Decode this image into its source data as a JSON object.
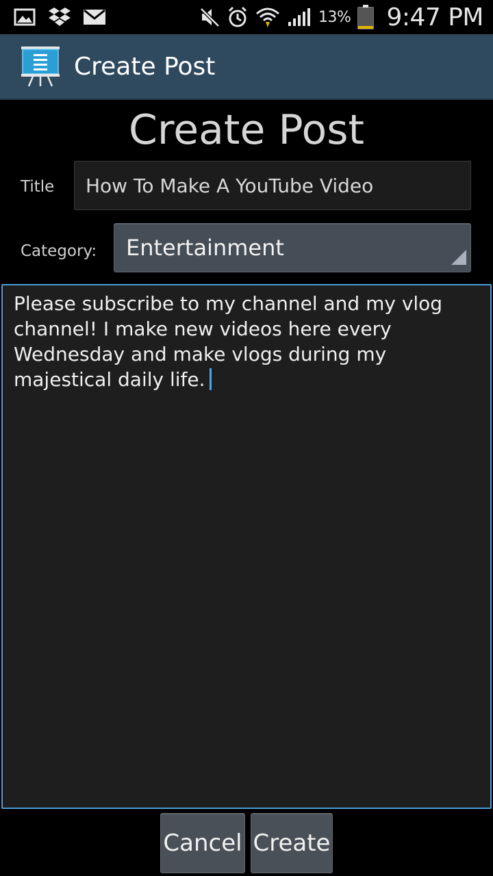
{
  "status_bar": {
    "battery_percent": "13%",
    "time": "9:47 PM",
    "icons": [
      "gallery-icon",
      "dropbox-icon",
      "mail-icon",
      "mute-icon",
      "alarm-icon",
      "wifi-icon",
      "signal-icon",
      "battery-icon"
    ]
  },
  "action_bar": {
    "title": "Create Post",
    "icon": "presentation-board-icon"
  },
  "form": {
    "heading": "Create Post",
    "title_label": "Title",
    "title_value": "How To Make A YouTube Video",
    "category_label": "Category:",
    "category_value": "Entertainment",
    "body_text": "Please subscribe to my channel and my vlog channel! I make new videos here every Wednesday and make vlogs during my majestical daily life."
  },
  "buttons": {
    "cancel_label": "Cancel",
    "create_label": "Create"
  },
  "colors": {
    "action_bar": "#2f4a5f",
    "focus_border": "#4a9fd8",
    "button": "#4a5057"
  }
}
